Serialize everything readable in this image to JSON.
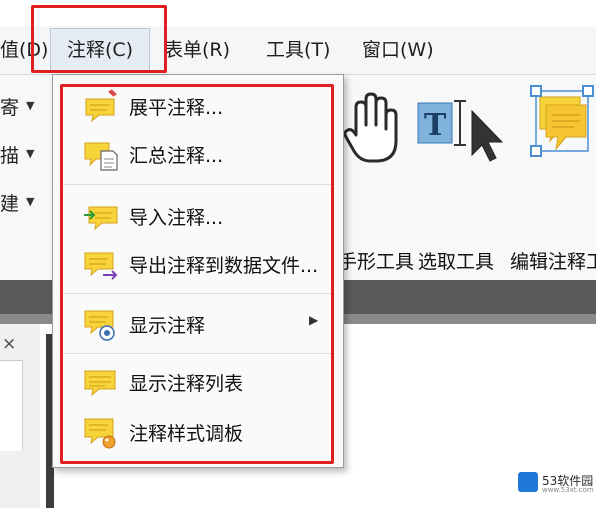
{
  "menubar": {
    "items": [
      {
        "label": "值(D)"
      },
      {
        "label": "注释(C)"
      },
      {
        "label": "表单(R)"
      },
      {
        "label": "工具(T)"
      },
      {
        "label": "窗口(W)"
      }
    ]
  },
  "ribbon": {
    "left_fragments": [
      {
        "text": "寄"
      },
      {
        "text": "描"
      },
      {
        "text": "建"
      }
    ],
    "tools": [
      {
        "label": "手形工具",
        "icon": "hand-icon"
      },
      {
        "label": "选取工具",
        "icon": "select-text-cursor-icon"
      },
      {
        "label": "编辑注释工",
        "icon": "edit-annotation-icon"
      }
    ]
  },
  "dropdown": {
    "items": [
      {
        "label": "展平注释...",
        "icon": "flatten-annotation-icon"
      },
      {
        "label": "汇总注释...",
        "icon": "summarize-annotation-icon"
      },
      {
        "label": "导入注释...",
        "icon": "import-annotation-icon"
      },
      {
        "label": "导出注释到数据文件...",
        "icon": "export-annotation-icon"
      },
      {
        "label": "显示注释",
        "icon": "show-annotation-icon",
        "has_submenu": true
      },
      {
        "label": "显示注释列表",
        "icon": "annotation-list-icon"
      },
      {
        "label": "注释样式调板",
        "icon": "annotation-style-palette-icon"
      }
    ]
  },
  "left_panel": {
    "close_glyph": "×"
  },
  "watermark": {
    "text": "53软件园",
    "subtext": "www.53xt.com"
  },
  "colors": {
    "highlight_red": "#e02020",
    "note_yellow": "#f7d43a",
    "note_yellow_shade": "#eab31e"
  }
}
